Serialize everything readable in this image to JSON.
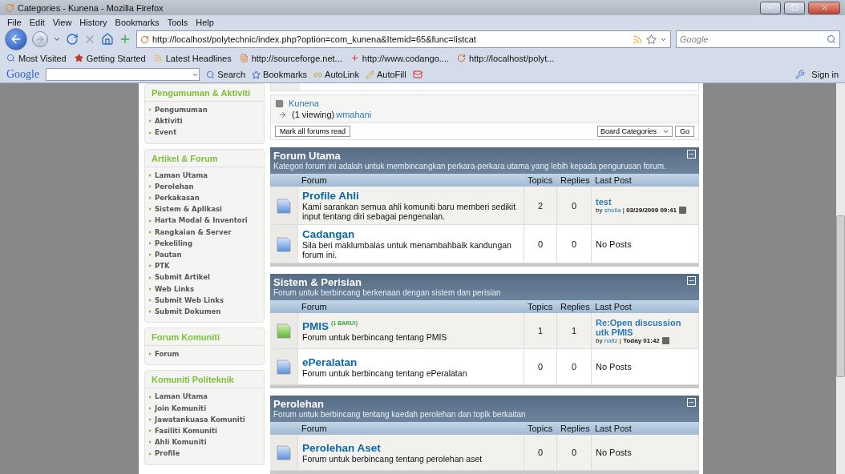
{
  "window": {
    "title": "Categories - Kunena - Mozilla Firefox"
  },
  "menu": [
    "File",
    "Edit",
    "View",
    "History",
    "Bookmarks",
    "Tools",
    "Help"
  ],
  "navigation": {
    "url": "http://localhost/polytechnic/index.php?option=com_kunena&Itemid=65&func=listcat",
    "search_placeholder": "Google"
  },
  "bookmarks": [
    "Most Visited",
    "Getting Started",
    "Latest Headlines",
    "http://sourceforge.net...",
    "http://www.codango....",
    "http://localhost/polyt..."
  ],
  "google_toolbar": {
    "logo": "Google",
    "items": [
      "Search",
      "Bookmarks",
      "AutoLink",
      "AutoFill"
    ],
    "sign_in": "Sign in"
  },
  "sidebar": [
    {
      "title": "Pengumuman & Aktiviti",
      "items": [
        "Pengumuman",
        "Aktiviti",
        "Event"
      ]
    },
    {
      "title": "Artikel & Forum",
      "items": [
        "Laman Utama",
        "Perolehan",
        "Perkakasan",
        "Sistem & Aplikasi",
        "Harta Modal & Inventori",
        "Rangkaian & Server",
        "Pekeliling",
        "Pautan",
        "PTK",
        "Submit Artikel",
        "Web Links",
        "Submit Web Links",
        "Submit Dokumen"
      ]
    },
    {
      "title": "Forum Komuniti",
      "items": [
        "Forum"
      ]
    },
    {
      "title": "Komuniti Politeknik",
      "items": [
        "Laman Utama",
        "Join Komuniti",
        "Jawatankuasa Komuniti",
        "Fasiliti Komuniti",
        "Ahli Komuniti",
        "Profile"
      ]
    }
  ],
  "breadcrumb": {
    "forum": "Kunena",
    "viewing": "(1 viewing)",
    "user": "wmahani"
  },
  "mark_read_button": "Mark all forums read",
  "board_select": "Board Categories",
  "go_button": "Go",
  "categories": [
    {
      "title": "Forum Utama",
      "description": "Kategori forum ini adalah untuk membincangkan perkara-perkara utama yang lebih kepada pengurusan forum.",
      "columns": [
        "Forum",
        "Topics",
        "Replies",
        "Last Post"
      ],
      "forums": [
        {
          "name": "Profile Ahli",
          "description": "Kami sarankan semua ahli komuniti baru memberi sedikit input tentang diri sebagai pengenalan.",
          "unread": false,
          "topics": "2",
          "replies": "0",
          "last_post": {
            "kind": "post",
            "title": "test",
            "prefix": "by",
            "author": "sheila",
            "suffix": "| **03/29/2009 09:41**"
          }
        },
        {
          "name": "Cadangan",
          "description": "Sila beri maklumbalas untuk menambahbaik kandungan forum ini.",
          "unread": false,
          "topics": "0",
          "replies": "0",
          "last_post": {
            "kind": "none",
            "text": "No Posts"
          }
        }
      ]
    },
    {
      "title": "Sistem & Perisian",
      "description": "Forum untuk berbincang berkenaan dengan sistem dan perisian",
      "columns": [
        "Forum",
        "Topics",
        "Replies",
        "Last Post"
      ],
      "forums": [
        {
          "name": "PMIS",
          "badge": "(1 BARU!)",
          "description": "Forum untuk berbincang tentang PMIS",
          "unread": true,
          "topics": "1",
          "replies": "1",
          "last_post": {
            "kind": "post",
            "title": "Re:Open discussion utk PMIS",
            "prefix": "by",
            "author": "hafiz",
            "suffix": "| **Today 01:42**"
          }
        },
        {
          "name": "ePeralatan",
          "description": "Forum untuk berbincang tentang ePeralatan",
          "unread": false,
          "topics": "0",
          "replies": "0",
          "last_post": {
            "kind": "none",
            "text": "No Posts"
          }
        }
      ]
    },
    {
      "title": "Perolehan",
      "description": "Forum untuk berbincang tentang kaedah perolehan dan topik berkaitan",
      "columns": [
        "Forum",
        "Topics",
        "Replies",
        "Last Post"
      ],
      "forums": [
        {
          "name": "Perolehan Aset",
          "description": "Forum untuk berbincang tentang perolehan aset",
          "unread": false,
          "topics": "0",
          "replies": "0",
          "last_post": {
            "kind": "none",
            "text": "No Posts"
          }
        }
      ]
    }
  ]
}
